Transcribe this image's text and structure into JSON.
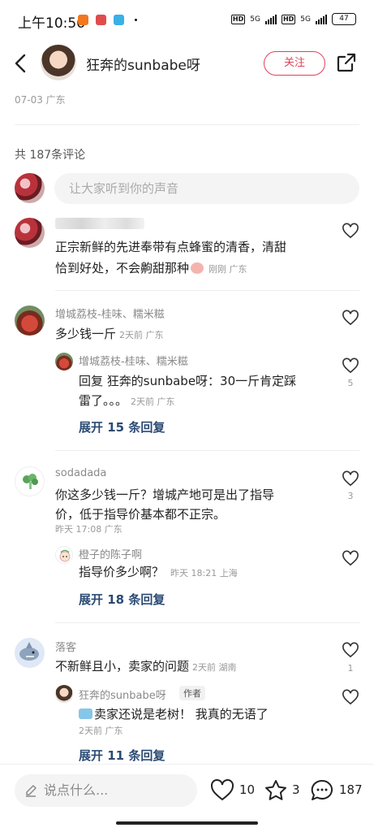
{
  "status": {
    "time": "上午10:56",
    "network1": "5G",
    "network2": "5G",
    "battery": "47"
  },
  "header": {
    "author": "狂奔的sunbabe呀",
    "follow_label": "关注"
  },
  "post": {
    "meta": "07-03 广东"
  },
  "comments_header": {
    "count_label": "共 187条评论",
    "input_placeholder": "让大家听到你的声音"
  },
  "comments": [
    {
      "username": "",
      "text_line1": "正宗新鲜的先进奉带有点蜂蜜的清香，清甜",
      "text_line2": "恰到好处，不会齁甜那种",
      "meta": "刚刚  广东"
    },
    {
      "username": "增城荔枝-桂味、糯米糍",
      "text": "多少钱一斤",
      "meta": "2天前  广东",
      "reply": {
        "username": "增城荔枝-桂味、糯米糍",
        "text_line1": "回复  狂奔的sunbabe呀：30一斤肯定踩",
        "text_line2": "雷了。。。",
        "meta": "2天前  广东",
        "likes": "5"
      },
      "expand": "展开 15 条回复"
    },
    {
      "username": "sodadada",
      "text_line1": "你这多少钱一斤？增城产地可是出了指导",
      "text_line2": "价，低于指导价基本都不正宗。",
      "meta": "昨天 17:08  广东",
      "likes": "3",
      "reply": {
        "username": "橙子的陈子啊",
        "text": "指导价多少啊？",
        "meta": "昨天 18:21  上海"
      },
      "expand": "展开 18 条回复"
    },
    {
      "username": "落客",
      "text": "不新鲜且小，卖家的问题",
      "meta": "2天前  湖南",
      "likes": "1",
      "reply": {
        "username": "狂奔的sunbabe呀",
        "author_tag": "作者",
        "text": "卖家还说是老树！ 我真的无语了",
        "meta": "2天前  广东"
      },
      "expand": "展开 11 条回复"
    }
  ],
  "bottom": {
    "placeholder": "说点什么...",
    "likes": "10",
    "stars": "3",
    "comments": "187"
  }
}
